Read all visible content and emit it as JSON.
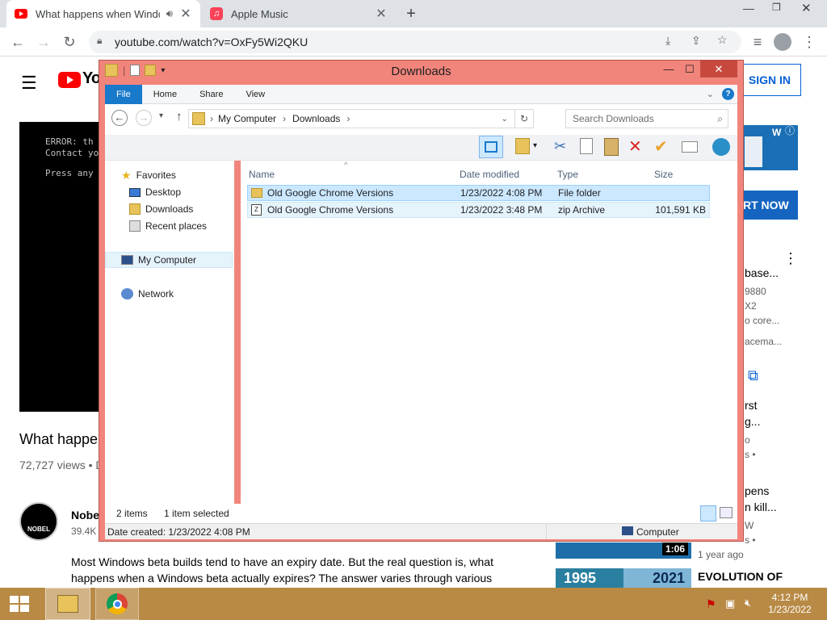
{
  "browser": {
    "tabs": [
      {
        "title": "What happens when Windows beta expires",
        "active": true
      },
      {
        "title": "Apple Music",
        "active": false
      }
    ],
    "url": "youtube.com/watch?v=OxFy5Wi2QKU"
  },
  "youtube": {
    "sign_in": "SIGN IN",
    "video_error_lines": [
      "ERROR: th",
      "Contact yo",
      "",
      "Press any"
    ],
    "video_title": "What happen",
    "views": "72,727 views • D",
    "channel_name": "Nobel",
    "channel_subs": "39.4K",
    "channel_logo_text": "NOBEL",
    "description_lines": [
      "Most Windows beta builds tend to have an expiry date. But the real question is, what",
      "happens when a Windows beta actually expires? The answer varies through various"
    ],
    "ad_button": "RT NOW",
    "side_texts": [
      {
        "text": "base...",
        "dark": true
      },
      {
        "text": "9880",
        "dark": false
      },
      {
        "text": "X2",
        "dark": false
      },
      {
        "text": "o core...",
        "dark": false
      },
      {
        "text": "acema...",
        "dark": false
      },
      {
        "text": "rst",
        "dark": true
      },
      {
        "text": "g...",
        "dark": true
      },
      {
        "text": "o",
        "dark": false
      },
      {
        "text": "s •",
        "dark": false
      },
      {
        "text": "pens",
        "dark": true
      },
      {
        "text": "n kill...",
        "dark": true
      },
      {
        "text": "W",
        "dark": false
      },
      {
        "text": "s •",
        "dark": false
      }
    ],
    "thumb_duration": "1:06",
    "thumb_age": "1 year ago",
    "evo_left": "1995",
    "evo_right": "2021",
    "evo_title": "EVOLUTION OF"
  },
  "explorer": {
    "title": "Downloads",
    "ribbon_tabs": [
      "File",
      "Home",
      "Share",
      "View"
    ],
    "breadcrumb": [
      "My Computer",
      "Downloads"
    ],
    "search_placeholder": "Search Downloads",
    "nav": {
      "favorites": "Favorites",
      "desktop": "Desktop",
      "downloads": "Downloads",
      "recent": "Recent places",
      "computer": "My Computer",
      "network": "Network"
    },
    "columns": [
      "Name",
      "Date modified",
      "Type",
      "Size"
    ],
    "files": [
      {
        "name": "Old Google Chrome Versions",
        "date": "1/23/2022 4:08 PM",
        "type": "File folder",
        "size": "",
        "icon": "folder-icon"
      },
      {
        "name": "Old Google Chrome Versions",
        "date": "1/23/2022 3:48 PM",
        "type": "zip Archive",
        "size": "101,591 KB",
        "icon": "zip-icon"
      }
    ],
    "status_items": "2 items",
    "status_selected": "1 item selected",
    "details_created": "Date created: 1/23/2022 4:08 PM",
    "details_location": "Computer"
  },
  "taskbar": {
    "time": "4:12 PM",
    "date": "1/23/2022"
  },
  "colors": {
    "window_frame": "#f1857c",
    "ribbon_file": "#1979ca",
    "selection": "#cce8ff",
    "taskbar": "#b88a45"
  }
}
